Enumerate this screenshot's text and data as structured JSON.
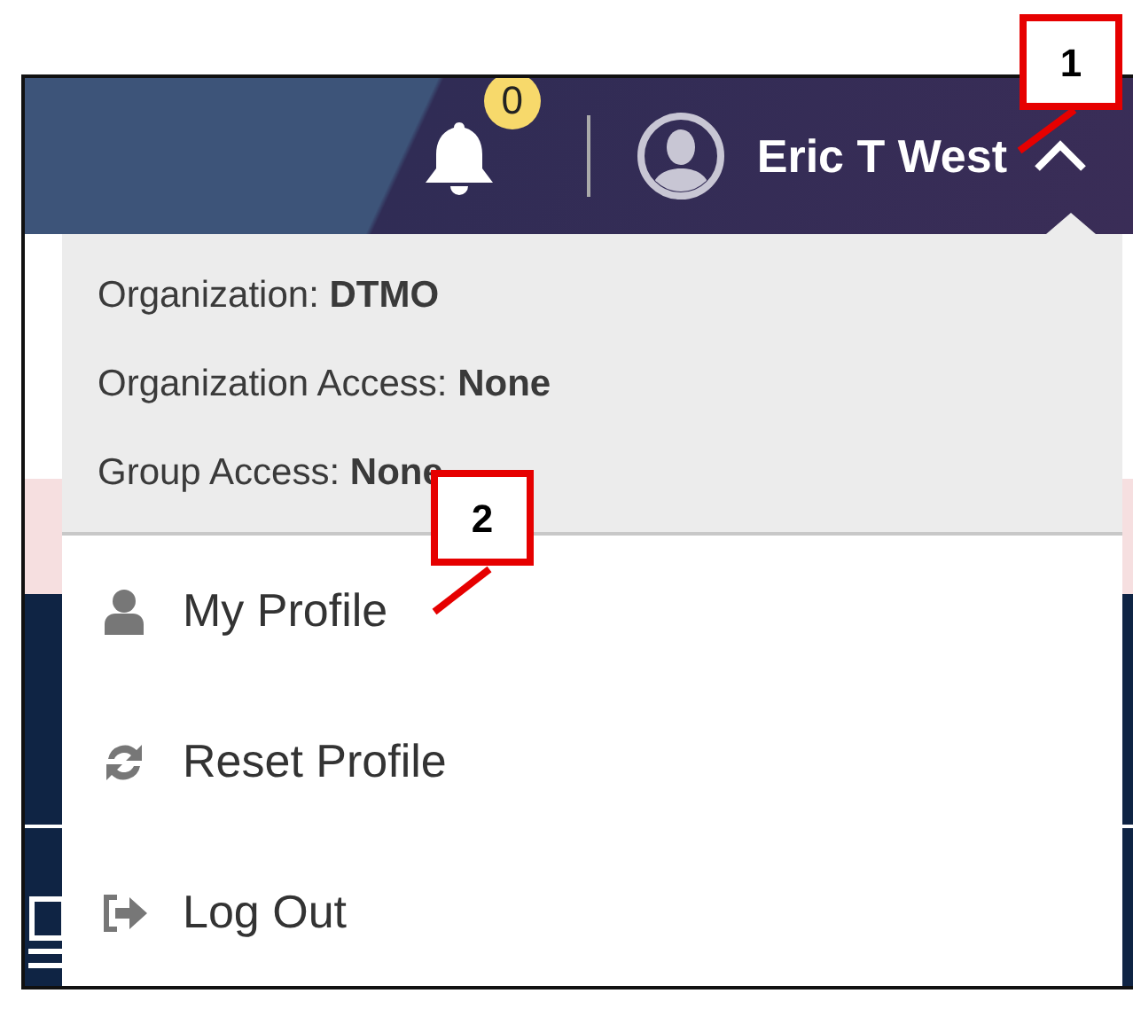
{
  "header": {
    "notification_count": "0",
    "user_name": "Eric T West",
    "menu_expanded": true
  },
  "account_info": [
    {
      "text": "Organization: **DTMO**"
    },
    {
      "text": "Organization Access: **None**"
    },
    {
      "text": "Group Access: **None**"
    }
  ],
  "menu_items": [
    {
      "kind": "profile",
      "label": "My Profile"
    },
    {
      "kind": "reset",
      "label": "Reset Profile"
    },
    {
      "kind": "logout",
      "label": "Log Out"
    }
  ],
  "callouts": [
    {
      "label": "1"
    },
    {
      "label": "2"
    }
  ]
}
